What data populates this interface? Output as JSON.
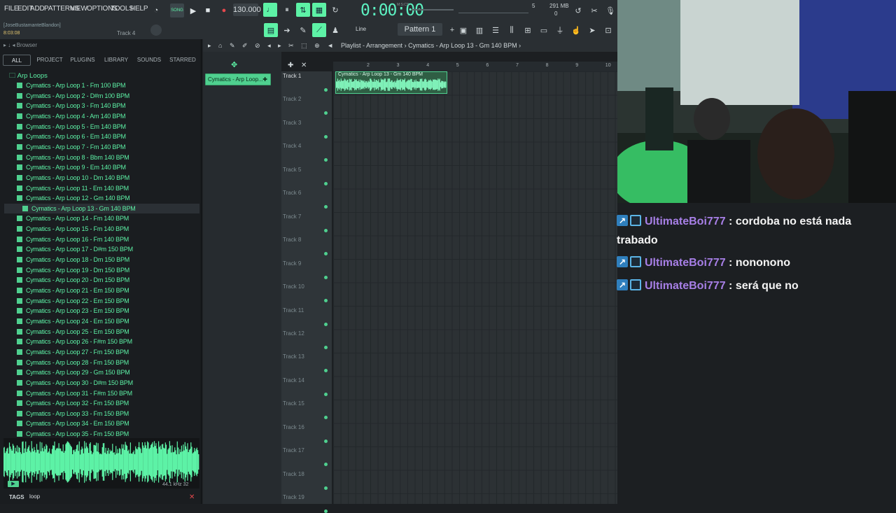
{
  "menu": [
    "FILE",
    "EDIT",
    "ADD",
    "PATTERNS",
    "VIEW",
    "OPTIONS",
    "TOOLS",
    "HELP"
  ],
  "toolbar": {
    "tempo": "130.000",
    "time": "0:00:00",
    "time_unit": "M:S:CS",
    "memory": "291 MB",
    "cpu": "0",
    "master_value": "5",
    "user_line": "[JoseBustamanteBlandon]",
    "clock": "8:03:08",
    "track_hint": "Track 4",
    "snap": "Line",
    "pattern": "Pattern 1"
  },
  "browser": {
    "header": "Browser",
    "tabs": [
      "ALL",
      "PROJECT",
      "PLUGINS",
      "LIBRARY",
      "SOUNDS",
      "STARRED"
    ],
    "active_tab": "ALL",
    "folder": "Arp Loops",
    "files": [
      "Cymatics - Arp Loop 1 - Fm 100 BPM",
      "Cymatics - Arp Loop 2 - D#m 100 BPM",
      "Cymatics - Arp Loop 3 - Fm 140 BPM",
      "Cymatics - Arp Loop 4 - Am 140 BPM",
      "Cymatics - Arp Loop 5 - Em 140 BPM",
      "Cymatics - Arp Loop 6 - Em 140 BPM",
      "Cymatics - Arp Loop 7 - Fm 140 BPM",
      "Cymatics - Arp Loop 8 - Bbm 140 BPM",
      "Cymatics - Arp Loop 9 - Em 140 BPM",
      "Cymatics - Arp Loop 10 - Dm 140 BPM",
      "Cymatics - Arp Loop 11 - Em 140 BPM",
      "Cymatics - Arp Loop 12 - Gm 140 BPM",
      "Cymatics - Arp Loop 13 - Gm 140 BPM",
      "Cymatics - Arp Loop 14 - Fm 140 BPM",
      "Cymatics - Arp Loop 15 - Fm 140 BPM",
      "Cymatics - Arp Loop 16 - Fm 140 BPM",
      "Cymatics - Arp Loop 17 - D#m 150 BPM",
      "Cymatics - Arp Loop 18 - Dm 150 BPM",
      "Cymatics - Arp Loop 19 - Dm 150 BPM",
      "Cymatics - Arp Loop 20 - Dm 150 BPM",
      "Cymatics - Arp Loop 21 - Em 150 BPM",
      "Cymatics - Arp Loop 22 - Em 150 BPM",
      "Cymatics - Arp Loop 23 - Em 150 BPM",
      "Cymatics - Arp Loop 24 - Em 150 BPM",
      "Cymatics - Arp Loop 25 - Em 150 BPM",
      "Cymatics - Arp Loop 26 - F#m 150 BPM",
      "Cymatics - Arp Loop 27 - Fm 150 BPM",
      "Cymatics - Arp Loop 28 - Fm 150 BPM",
      "Cymatics - Arp Loop 29 - Gm 150 BPM",
      "Cymatics - Arp Loop 30 - D#m 150 BPM",
      "Cymatics - Arp Loop 31 - F#m 150 BPM",
      "Cymatics - Arp Loop 32 - Fm 150 BPM",
      "Cymatics - Arp Loop 33 - Fm 150 BPM",
      "Cymatics - Arp Loop 34 - Em 150 BPM",
      "Cymatics - Arp Loop 35 - Fm 150 BPM"
    ],
    "selected_index": 12,
    "sample_rate": "44.1 kHz 32",
    "tags_label": "TAGS",
    "tags_value": "loop"
  },
  "channel": {
    "label": "Cymatics - Arp Loop..."
  },
  "playlist": {
    "title": "Playlist - Arrangement",
    "breadcrumb_sep": "›",
    "pattern_name": "Cymatics - Arp Loop 13 - Gm 140 BPM",
    "clip_label": "Cymatics - Arp Loop 13 - Gm 140 BPM",
    "ruler": [
      "2",
      "3",
      "4",
      "5",
      "6",
      "7",
      "8",
      "9",
      "10"
    ],
    "tracks": [
      "Track 1",
      "Track 2",
      "Track 3",
      "Track 4",
      "Track 5",
      "Track 6",
      "Track 7",
      "Track 8",
      "Track 9",
      "Track 10",
      "Track 11",
      "Track 12",
      "Track 13",
      "Track 14",
      "Track 15",
      "Track 16",
      "Track 17",
      "Track 18",
      "Track 19"
    ]
  },
  "chat": [
    {
      "user": "UltimateBoi777",
      "sep": " : ",
      "text": "cordoba no está nada trabado"
    },
    {
      "user": "UltimateBoi777",
      "sep": " : ",
      "text": "nononono"
    },
    {
      "user": "UltimateBoi777",
      "sep": " : ",
      "text": "será que no"
    }
  ],
  "colors": {
    "accent": "#5df2a6",
    "username": "#a77fe6",
    "chat_text": "#f4f4f4"
  }
}
